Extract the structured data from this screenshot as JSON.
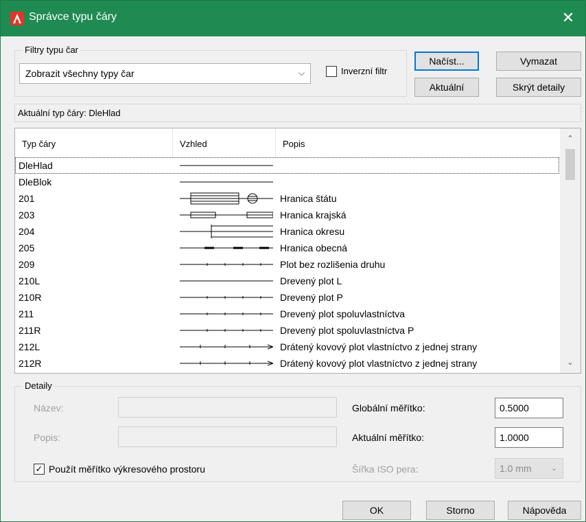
{
  "window": {
    "title": "Správce typu čáry",
    "close_glyph": "✕",
    "icon": "autocad-a-icon",
    "accent": "#1f8a52"
  },
  "filters": {
    "legend": "Filtry typu čar",
    "dropdown_value": "Zobrazit všechny typy čar",
    "invert_label": "Inverzní filtr",
    "invert_checked": false
  },
  "buttons": {
    "load": "Načíst...",
    "delete": "Vymazat",
    "current": "Aktuální",
    "hide_details": "Skrýt detaily",
    "ok": "OK",
    "cancel": "Storno",
    "help": "Nápověda"
  },
  "current_linetype": "Aktuální typ čáry:  DleHlad",
  "list": {
    "headers": [
      "Typ čáry",
      "Vzhled",
      "Popis"
    ],
    "rows": [
      {
        "name": "DleHlad",
        "desc": "",
        "look": "solid"
      },
      {
        "name": "DleBlok",
        "desc": "",
        "look": "solid"
      },
      {
        "name": "201",
        "desc": "Hranica štátu",
        "look": "state"
      },
      {
        "name": "203",
        "desc": "Hranica krajská",
        "look": "region"
      },
      {
        "name": "204",
        "desc": "Hranica okresu",
        "look": "district"
      },
      {
        "name": "205",
        "desc": "Hranica obecná",
        "look": "dash"
      },
      {
        "name": "209",
        "desc": "Plot bez rozlišenia druhu",
        "look": "ticks"
      },
      {
        "name": "210L",
        "desc": "Drevený plot L",
        "look": "solid"
      },
      {
        "name": "210R",
        "desc": "Drevený plot P",
        "look": "ticks"
      },
      {
        "name": "211",
        "desc": "Drevený plot spoluvlastníctva",
        "look": "ticks"
      },
      {
        "name": "211R",
        "desc": "Drevený plot spoluvlastníctva P",
        "look": "ticks"
      },
      {
        "name": "212L",
        "desc": "Drátený kovový plot vlastníctvo z jednej strany",
        "look": "arrow"
      },
      {
        "name": "212R",
        "desc": "Drátený kovový plot vlastníctvo z jednej strany",
        "look": "arrow"
      }
    ]
  },
  "details": {
    "legend": "Detaily",
    "name_label": "Název:",
    "desc_label": "Popis:",
    "paper_space_label": "Použít měřítko výkresového prostoru",
    "paper_space_checked": true,
    "global_scale_label": "Globální měřítko:",
    "global_scale_value": "0.5000",
    "current_scale_label": "Aktuální měřítko:",
    "current_scale_value": "1.0000",
    "iso_pen_label": "Šířka ISO pera:",
    "iso_pen_value": "1.0 mm"
  }
}
